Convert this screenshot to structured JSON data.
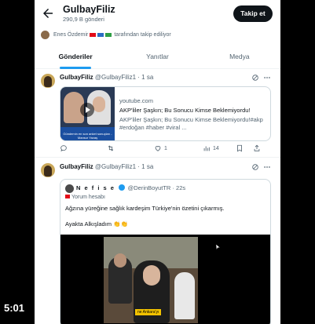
{
  "profile": {
    "name": "GulbayFiliz",
    "post_count": "290,9 B gönderi",
    "follow_label": "Takip et",
    "followed_by_prefix": "Enes Özdemir",
    "followed_by_suffix": "tarafından takip ediliyor"
  },
  "tabs": [
    {
      "label": "Gönderiler",
      "active": true
    },
    {
      "label": "Yanıtlar",
      "active": false
    },
    {
      "label": "Medya",
      "active": false
    }
  ],
  "tweet1": {
    "name": "GulbayFiliz",
    "handle": "@GulbayFiliz1",
    "time": "· 1 sa",
    "card": {
      "thumb_caption": "Gündemin en son anket sonuçları - Mansur Yavaş",
      "domain": "youtube.com",
      "title": "AKP'liler Şaşkın; Bu Sonucu Kimse Beklemiyordu!",
      "desc": "AKP'liler Şaşkın; Bu Sonucu Kimse Beklemiyordu!#akp #erdoğan #haber #viral ..."
    },
    "actions": {
      "reply": "",
      "retweet": "",
      "like": "1",
      "views": "14"
    }
  },
  "tweet2": {
    "name": "GulbayFiliz",
    "handle": "@GulbayFiliz1",
    "time": "· 1 sa",
    "quote": {
      "name": "N e f i s e",
      "handle": "@DerinBoyutTR",
      "time": "· 22s",
      "note": "Yorum hesabı",
      "line1": "Ağzına yüreğine sağlık kardeşim Türkiye'nin özetini çıkarmış.",
      "line2": "Ayakta Alkışladım 👏👏",
      "video_caption": "ne Ankara'yı"
    }
  },
  "timer": "5:01",
  "colors": {
    "accent": "#1d9bf0",
    "text": "#0f1419",
    "muted": "#536471",
    "button": "#0f1419"
  }
}
